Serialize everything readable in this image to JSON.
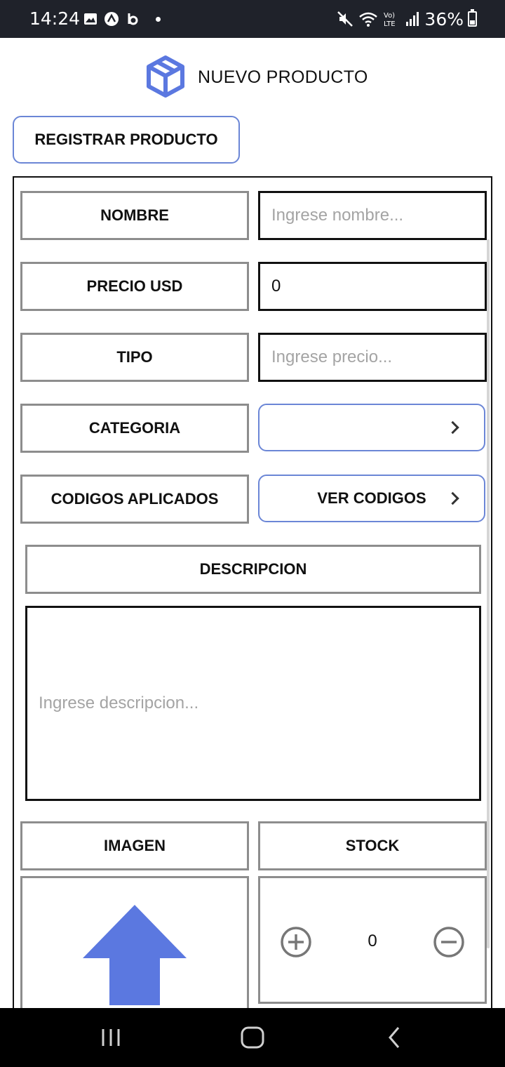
{
  "status_bar": {
    "time": "14:24",
    "left_icons": [
      "gallery-icon",
      "app-a-icon",
      "app-b-icon",
      "notification-dot"
    ],
    "right_icons": [
      "mute-icon",
      "wifi-icon",
      "volte-icon",
      "signal-icon"
    ],
    "battery": "36%"
  },
  "header": {
    "title": "NUEVO PRODUCTO",
    "logo": "box-icon"
  },
  "register_button": "REGISTRAR PRODUCTO",
  "form": {
    "nombre": {
      "label": "NOMBRE",
      "placeholder": "Ingrese nombre..."
    },
    "precio": {
      "label": "PRECIO USD",
      "value": "0"
    },
    "tipo": {
      "label": "TIPO",
      "placeholder": "Ingrese precio..."
    },
    "categoria": {
      "label": "CATEGORIA",
      "value": ""
    },
    "codigos": {
      "label": "CODIGOS APLICADOS",
      "button": "VER CODIGOS"
    },
    "descripcion": {
      "label": "DESCRIPCION",
      "placeholder": "Ingrese descripcion..."
    },
    "imagen": {
      "label": "IMAGEN"
    },
    "stock": {
      "label": "STOCK",
      "value": "0"
    }
  },
  "colors": {
    "accent": "#5b78e0",
    "status_bar": "#1f222a",
    "label_border": "#8d8d8d"
  },
  "nav_bar": [
    "recents-icon",
    "home-icon",
    "back-icon"
  ]
}
